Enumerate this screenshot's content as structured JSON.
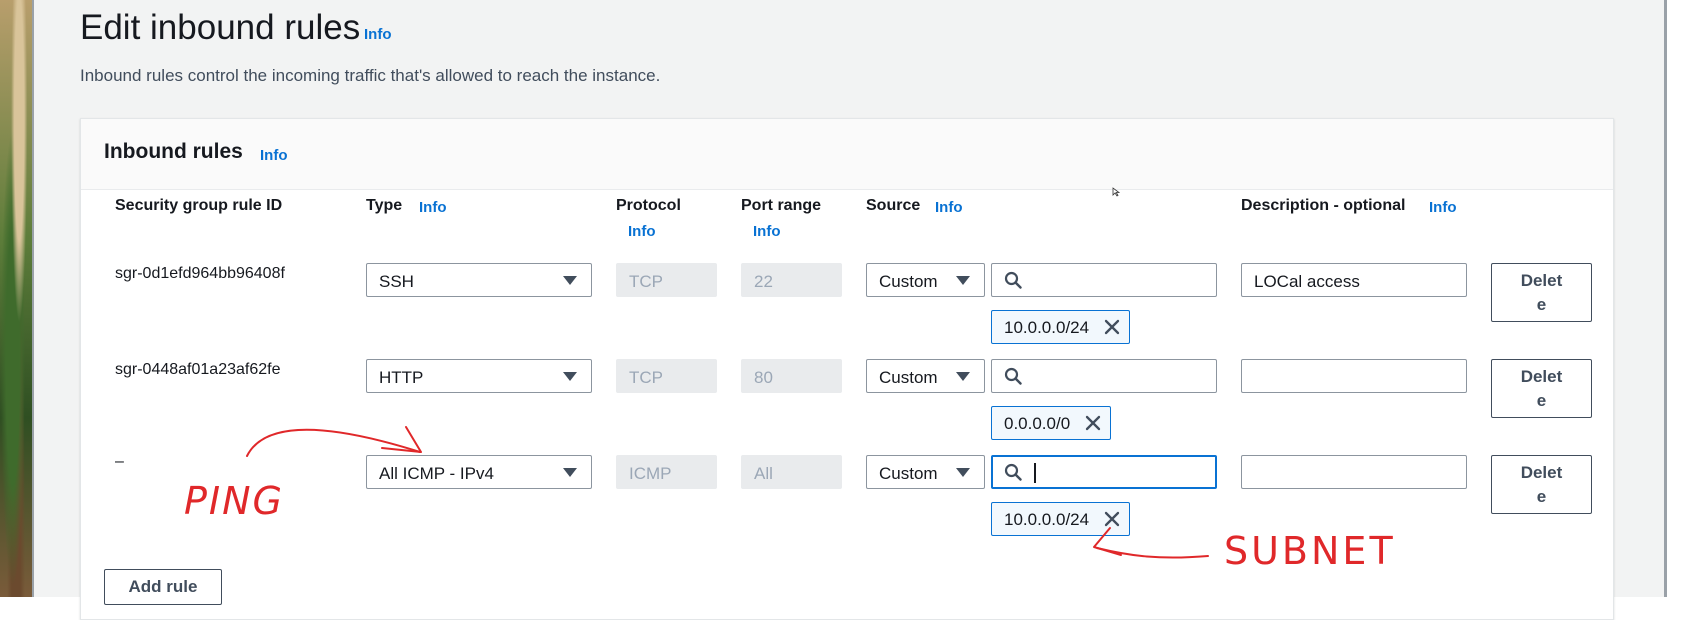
{
  "page": {
    "title": "Edit inbound rules",
    "title_info": "Info",
    "description": "Inbound rules control the incoming traffic that's allowed to reach the instance."
  },
  "panel": {
    "title": "Inbound rules",
    "title_info": "Info"
  },
  "columns": {
    "rule_id": "Security group rule ID",
    "type": "Type",
    "type_info": "Info",
    "protocol": "Protocol",
    "protocol_info": "Info",
    "port_range": "Port range",
    "port_range_info": "Info",
    "source": "Source",
    "source_info": "Info",
    "description": "Description - optional",
    "description_info": "Info"
  },
  "rules": [
    {
      "id": "sgr-0d1efd964bb96408f",
      "type": "SSH",
      "protocol": "TCP",
      "port_range": "22",
      "source_type": "Custom",
      "source_token": "10.0.0.0/24",
      "description": "LOCal access",
      "delete_label_1": "Delet",
      "delete_label_2": "e"
    },
    {
      "id": "sgr-0448af01a23af62fe",
      "type": "HTTP",
      "protocol": "TCP",
      "port_range": "80",
      "source_type": "Custom",
      "source_token": "0.0.0.0/0",
      "description": "",
      "delete_label_1": "Delet",
      "delete_label_2": "e"
    },
    {
      "id": "–",
      "type": "All ICMP - IPv4",
      "protocol": "ICMP",
      "port_range": "All",
      "source_type": "Custom",
      "source_token": "10.0.0.0/24",
      "description": "",
      "delete_label_1": "Delet",
      "delete_label_2": "e"
    }
  ],
  "add_rule_label": "Add rule",
  "annotations": {
    "ping": "PING",
    "subnet": "SUBNET",
    "color": "#e0282a"
  },
  "icons": {
    "search": "search-icon",
    "dropdown": "caret-down-icon",
    "remove_token": "close-icon"
  }
}
